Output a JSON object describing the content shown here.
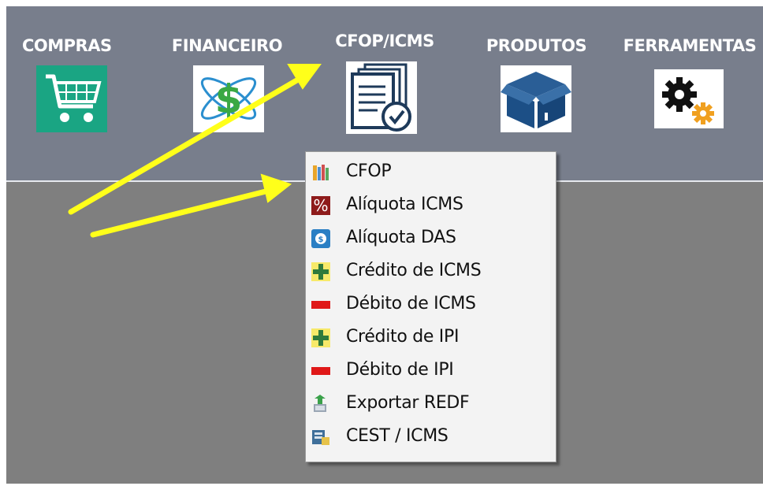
{
  "toolbar": {
    "menus": [
      {
        "label": "COMPRAS",
        "icon": "shopping-cart-icon"
      },
      {
        "label": "FINANCEIRO",
        "icon": "dollar-atom-icon"
      },
      {
        "label": "CFOP/ICMS",
        "icon": "documents-check-icon"
      },
      {
        "label": "PRODUTOS",
        "icon": "box-icon"
      },
      {
        "label": "FERRAMENTAS",
        "icon": "gears-icon"
      }
    ]
  },
  "dropdown": {
    "items": [
      {
        "label": "CFOP",
        "icon": "books-icon"
      },
      {
        "label": "Alíquota ICMS",
        "icon": "percent-icon"
      },
      {
        "label": "Alíquota DAS",
        "icon": "coin-icon"
      },
      {
        "label": "Crédito de ICMS",
        "icon": "plus-icon"
      },
      {
        "label": "Débito de ICMS",
        "icon": "minus-icon"
      },
      {
        "label": "Crédito de IPI",
        "icon": "plus-icon"
      },
      {
        "label": "Débito de IPI",
        "icon": "minus-icon"
      },
      {
        "label": "Exportar REDF",
        "icon": "export-icon"
      },
      {
        "label": "CEST / ICMS",
        "icon": "cest-icon"
      }
    ]
  },
  "colors": {
    "toolbar_bg": "#787e8c",
    "workspace_bg": "#7f7f7f",
    "annotation_arrow": "#ffff1a",
    "cart_green": "#1aa583",
    "box_blue": "#1c4f86"
  }
}
